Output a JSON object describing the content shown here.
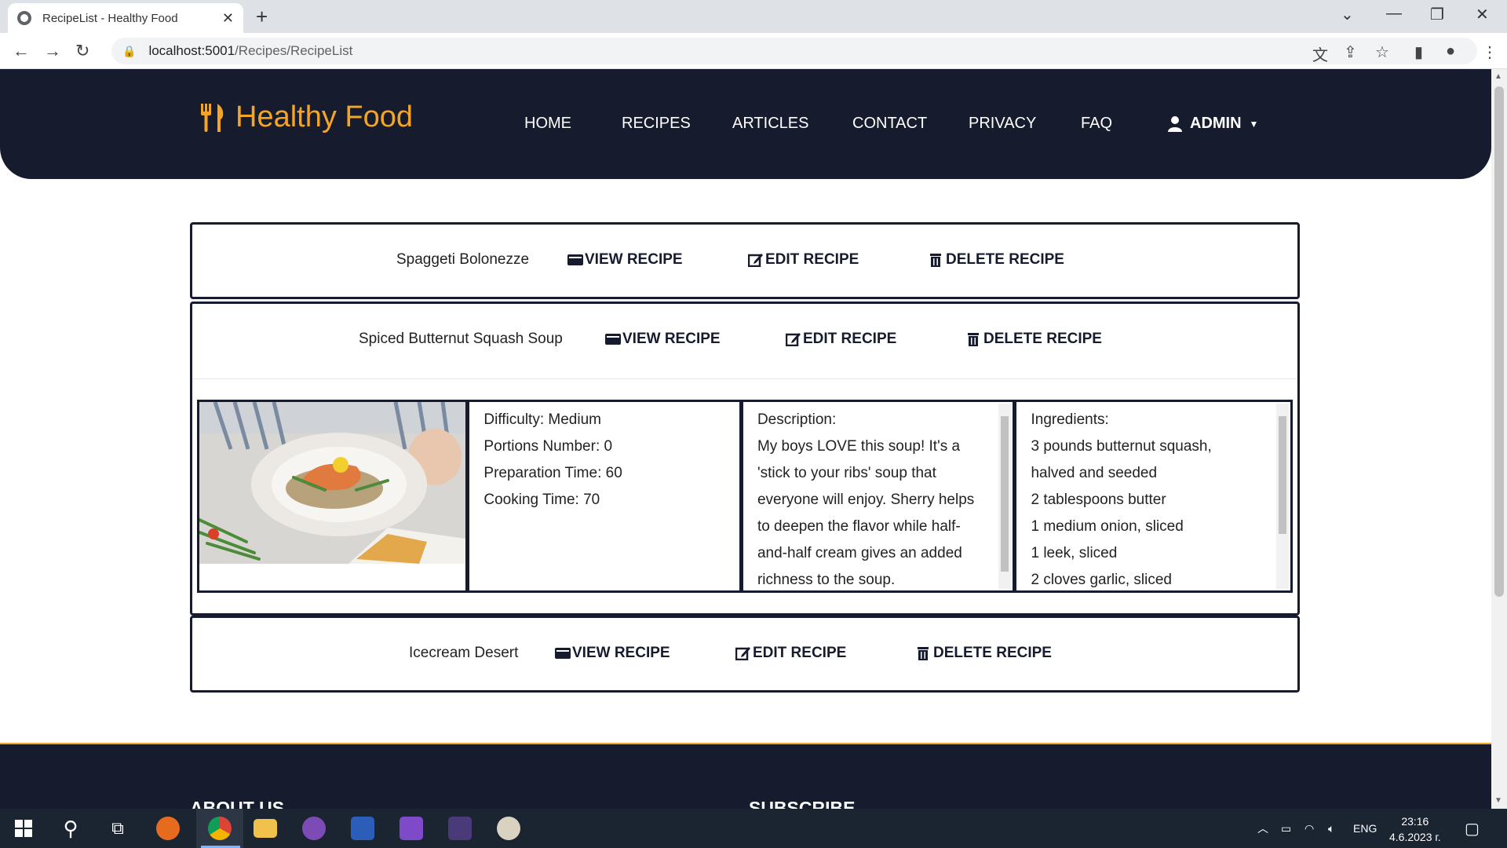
{
  "browser": {
    "tab_title": "RecipeList - Healthy Food",
    "url_host": "localhost:5001",
    "url_path": "/Recipes/RecipeList"
  },
  "site": {
    "brand": "Healthy Food",
    "nav": [
      "HOME",
      "RECIPES",
      "ARTICLES",
      "CONTACT",
      "PRIVACY",
      "FAQ"
    ],
    "user_menu": "ADMIN"
  },
  "recipes": [
    {
      "name": "Spaggeti Bolonezze",
      "view_label": "VIEW RECIPE",
      "edit_label": "EDIT RECIPE",
      "delete_label": "DELETE RECIPE"
    },
    {
      "name": "Spiced Butternut Squash Soup",
      "view_label": "VIEW RECIPE",
      "edit_label": "EDIT RECIPE",
      "delete_label": "DELETE RECIPE",
      "details": {
        "difficulty": "Difficulty: Medium",
        "portions": "Portions Number: 0",
        "prep_time": "Preparation Time: 60",
        "cook_time": "Cooking Time: 70",
        "description_heading": "Description:",
        "description_lines": [
          "My boys LOVE this soup! It's a",
          "'stick to your ribs' soup that",
          "everyone will enjoy. Sherry helps",
          "to deepen the flavor while half-",
          "and-half cream gives an added",
          "richness to the soup."
        ],
        "ingredients_heading": "Ingredients:",
        "ingredients_lines": [
          "3 pounds butternut squash,",
          "halved and seeded",
          "2 tablespoons butter",
          "1 medium onion, sliced",
          "1 leek, sliced",
          "2 cloves garlic, sliced"
        ]
      }
    },
    {
      "name": "Icecream Desert",
      "view_label": "VIEW RECIPE",
      "edit_label": "EDIT RECIPE",
      "delete_label": "DELETE RECIPE"
    }
  ],
  "footer": {
    "about": "ABOUT US",
    "subscribe": "SUBSCRIBE"
  },
  "taskbar": {
    "language": "ENG",
    "time": "23:16",
    "date": "4.6.2023 г."
  },
  "colors": {
    "navy": "#161b2d",
    "accent": "#f5a524"
  }
}
